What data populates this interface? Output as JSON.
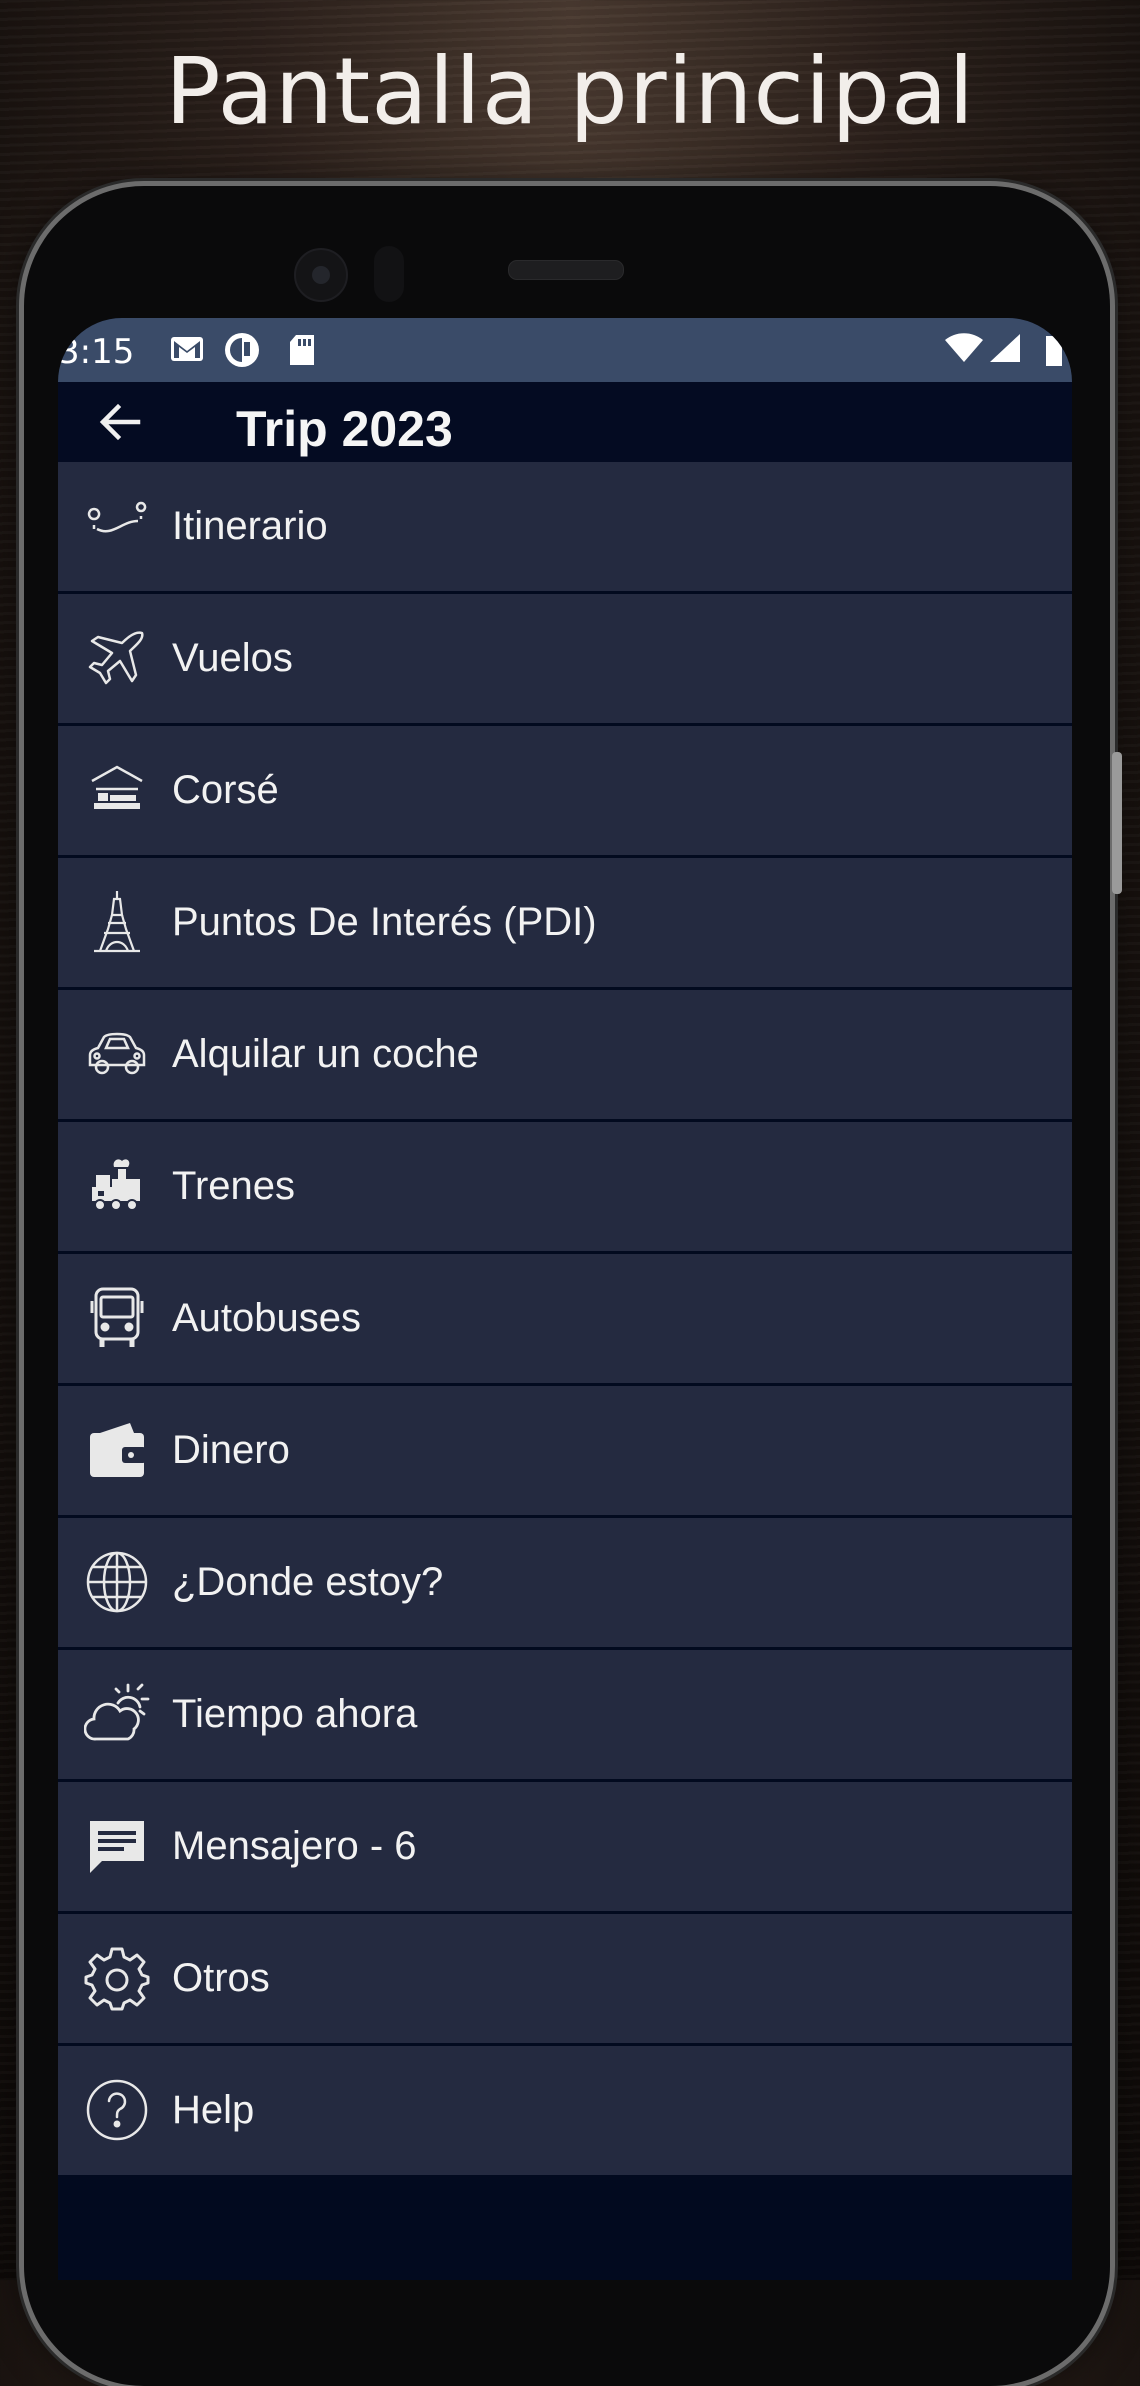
{
  "header": {
    "headline": "Pantalla principal"
  },
  "status_bar": {
    "time": "3:15"
  },
  "app_bar": {
    "back_icon": "arrow-left-icon",
    "title": "Trip 2023"
  },
  "colors": {
    "screen_bg": "#020a1f",
    "item_bg": "#242a40",
    "status_bg": "#3a4b68",
    "appbar_bg": "#040b22"
  },
  "menu": {
    "items": [
      {
        "label": "Itinerario",
        "icon": "route-icon"
      },
      {
        "label": "Vuelos",
        "icon": "airplane-icon"
      },
      {
        "label": "Corsé",
        "icon": "hotel-bed-icon"
      },
      {
        "label": "Puntos De Interés (PDI)",
        "icon": "eiffel-tower-icon"
      },
      {
        "label": "Alquilar un coche",
        "icon": "car-icon"
      },
      {
        "label": "Trenes",
        "icon": "train-icon"
      },
      {
        "label": "Autobuses",
        "icon": "bus-icon"
      },
      {
        "label": "Dinero",
        "icon": "wallet-icon"
      },
      {
        "label": "¿Donde estoy?",
        "icon": "globe-icon"
      },
      {
        "label": "Tiempo ahora",
        "icon": "weather-icon"
      },
      {
        "label": "Mensajero - 6",
        "icon": "message-icon"
      },
      {
        "label": "Otros",
        "icon": "gear-icon"
      },
      {
        "label": "Help",
        "icon": "help-icon"
      }
    ]
  }
}
